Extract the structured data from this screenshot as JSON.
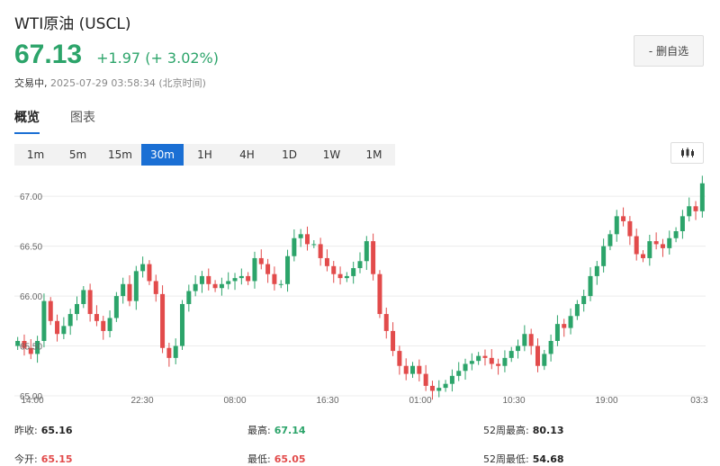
{
  "header": {
    "title": "WTI原油 (USCL)",
    "price": "67.13",
    "change": "+1.97 (+ 3.02%)",
    "status_label": "交易中,",
    "status_time": "2025-07-29 03:58:34 (北京时间)",
    "watch_button": "- 删自选"
  },
  "tabs": [
    {
      "label": "概览",
      "active": true
    },
    {
      "label": "图表",
      "active": false
    }
  ],
  "periods": [
    "1m",
    "5m",
    "15m",
    "30m",
    "1H",
    "4H",
    "1D",
    "1W",
    "1M"
  ],
  "active_period": "30m",
  "chart_type_icon": "candlestick-icon",
  "colors": {
    "up": "#2ca46a",
    "down": "#e24b4b",
    "accent": "#1a6fd4"
  },
  "chart_data": {
    "type": "candlestick",
    "y_ticks": [
      "65.00",
      "65.50",
      "66.00",
      "66.50",
      "67.00"
    ],
    "x_ticks": [
      "14:00",
      "22:30",
      "08:00",
      "16:30",
      "01:00",
      "10:30",
      "19:00",
      "03:3"
    ],
    "ylim": [
      65.0,
      67.2
    ],
    "closes": [
      65.55,
      65.48,
      65.42,
      65.55,
      65.95,
      65.75,
      65.62,
      65.7,
      65.82,
      65.92,
      66.06,
      65.82,
      65.75,
      65.65,
      65.78,
      66.0,
      66.12,
      65.95,
      66.25,
      66.32,
      66.15,
      66.02,
      65.48,
      65.38,
      65.5,
      65.92,
      66.05,
      66.12,
      66.2,
      66.12,
      66.08,
      66.12,
      66.15,
      66.18,
      66.2,
      66.15,
      66.38,
      66.32,
      66.22,
      66.12,
      66.12,
      66.4,
      66.58,
      66.62,
      66.52,
      66.52,
      66.38,
      66.3,
      66.22,
      66.18,
      66.2,
      66.28,
      66.35,
      66.55,
      66.22,
      65.82,
      65.65,
      65.45,
      65.3,
      65.22,
      65.3,
      65.22,
      65.1,
      65.05,
      65.08,
      65.12,
      65.2,
      65.25,
      65.32,
      65.35,
      65.4,
      65.38,
      65.32,
      65.3,
      65.38,
      65.45,
      65.5,
      65.62,
      65.5,
      65.3,
      65.42,
      65.55,
      65.72,
      65.68,
      65.8,
      65.92,
      66.0,
      66.2,
      66.3,
      66.5,
      66.62,
      66.8,
      66.75,
      66.6,
      66.42,
      66.38,
      66.55,
      66.52,
      66.48,
      66.58,
      66.65,
      66.8,
      66.9,
      66.85,
      67.13
    ]
  },
  "stats": [
    {
      "label": "昨收:",
      "value": "65.16",
      "tone": "dark"
    },
    {
      "label": "最高:",
      "value": "67.14",
      "tone": "up"
    },
    {
      "label": "52周最高:",
      "value": "80.13",
      "tone": "dark"
    },
    {
      "label": "今开:",
      "value": "65.15",
      "tone": "down"
    },
    {
      "label": "最低:",
      "value": "65.05",
      "tone": "down"
    },
    {
      "label": "52周最低:",
      "value": "54.68",
      "tone": "dark"
    }
  ]
}
